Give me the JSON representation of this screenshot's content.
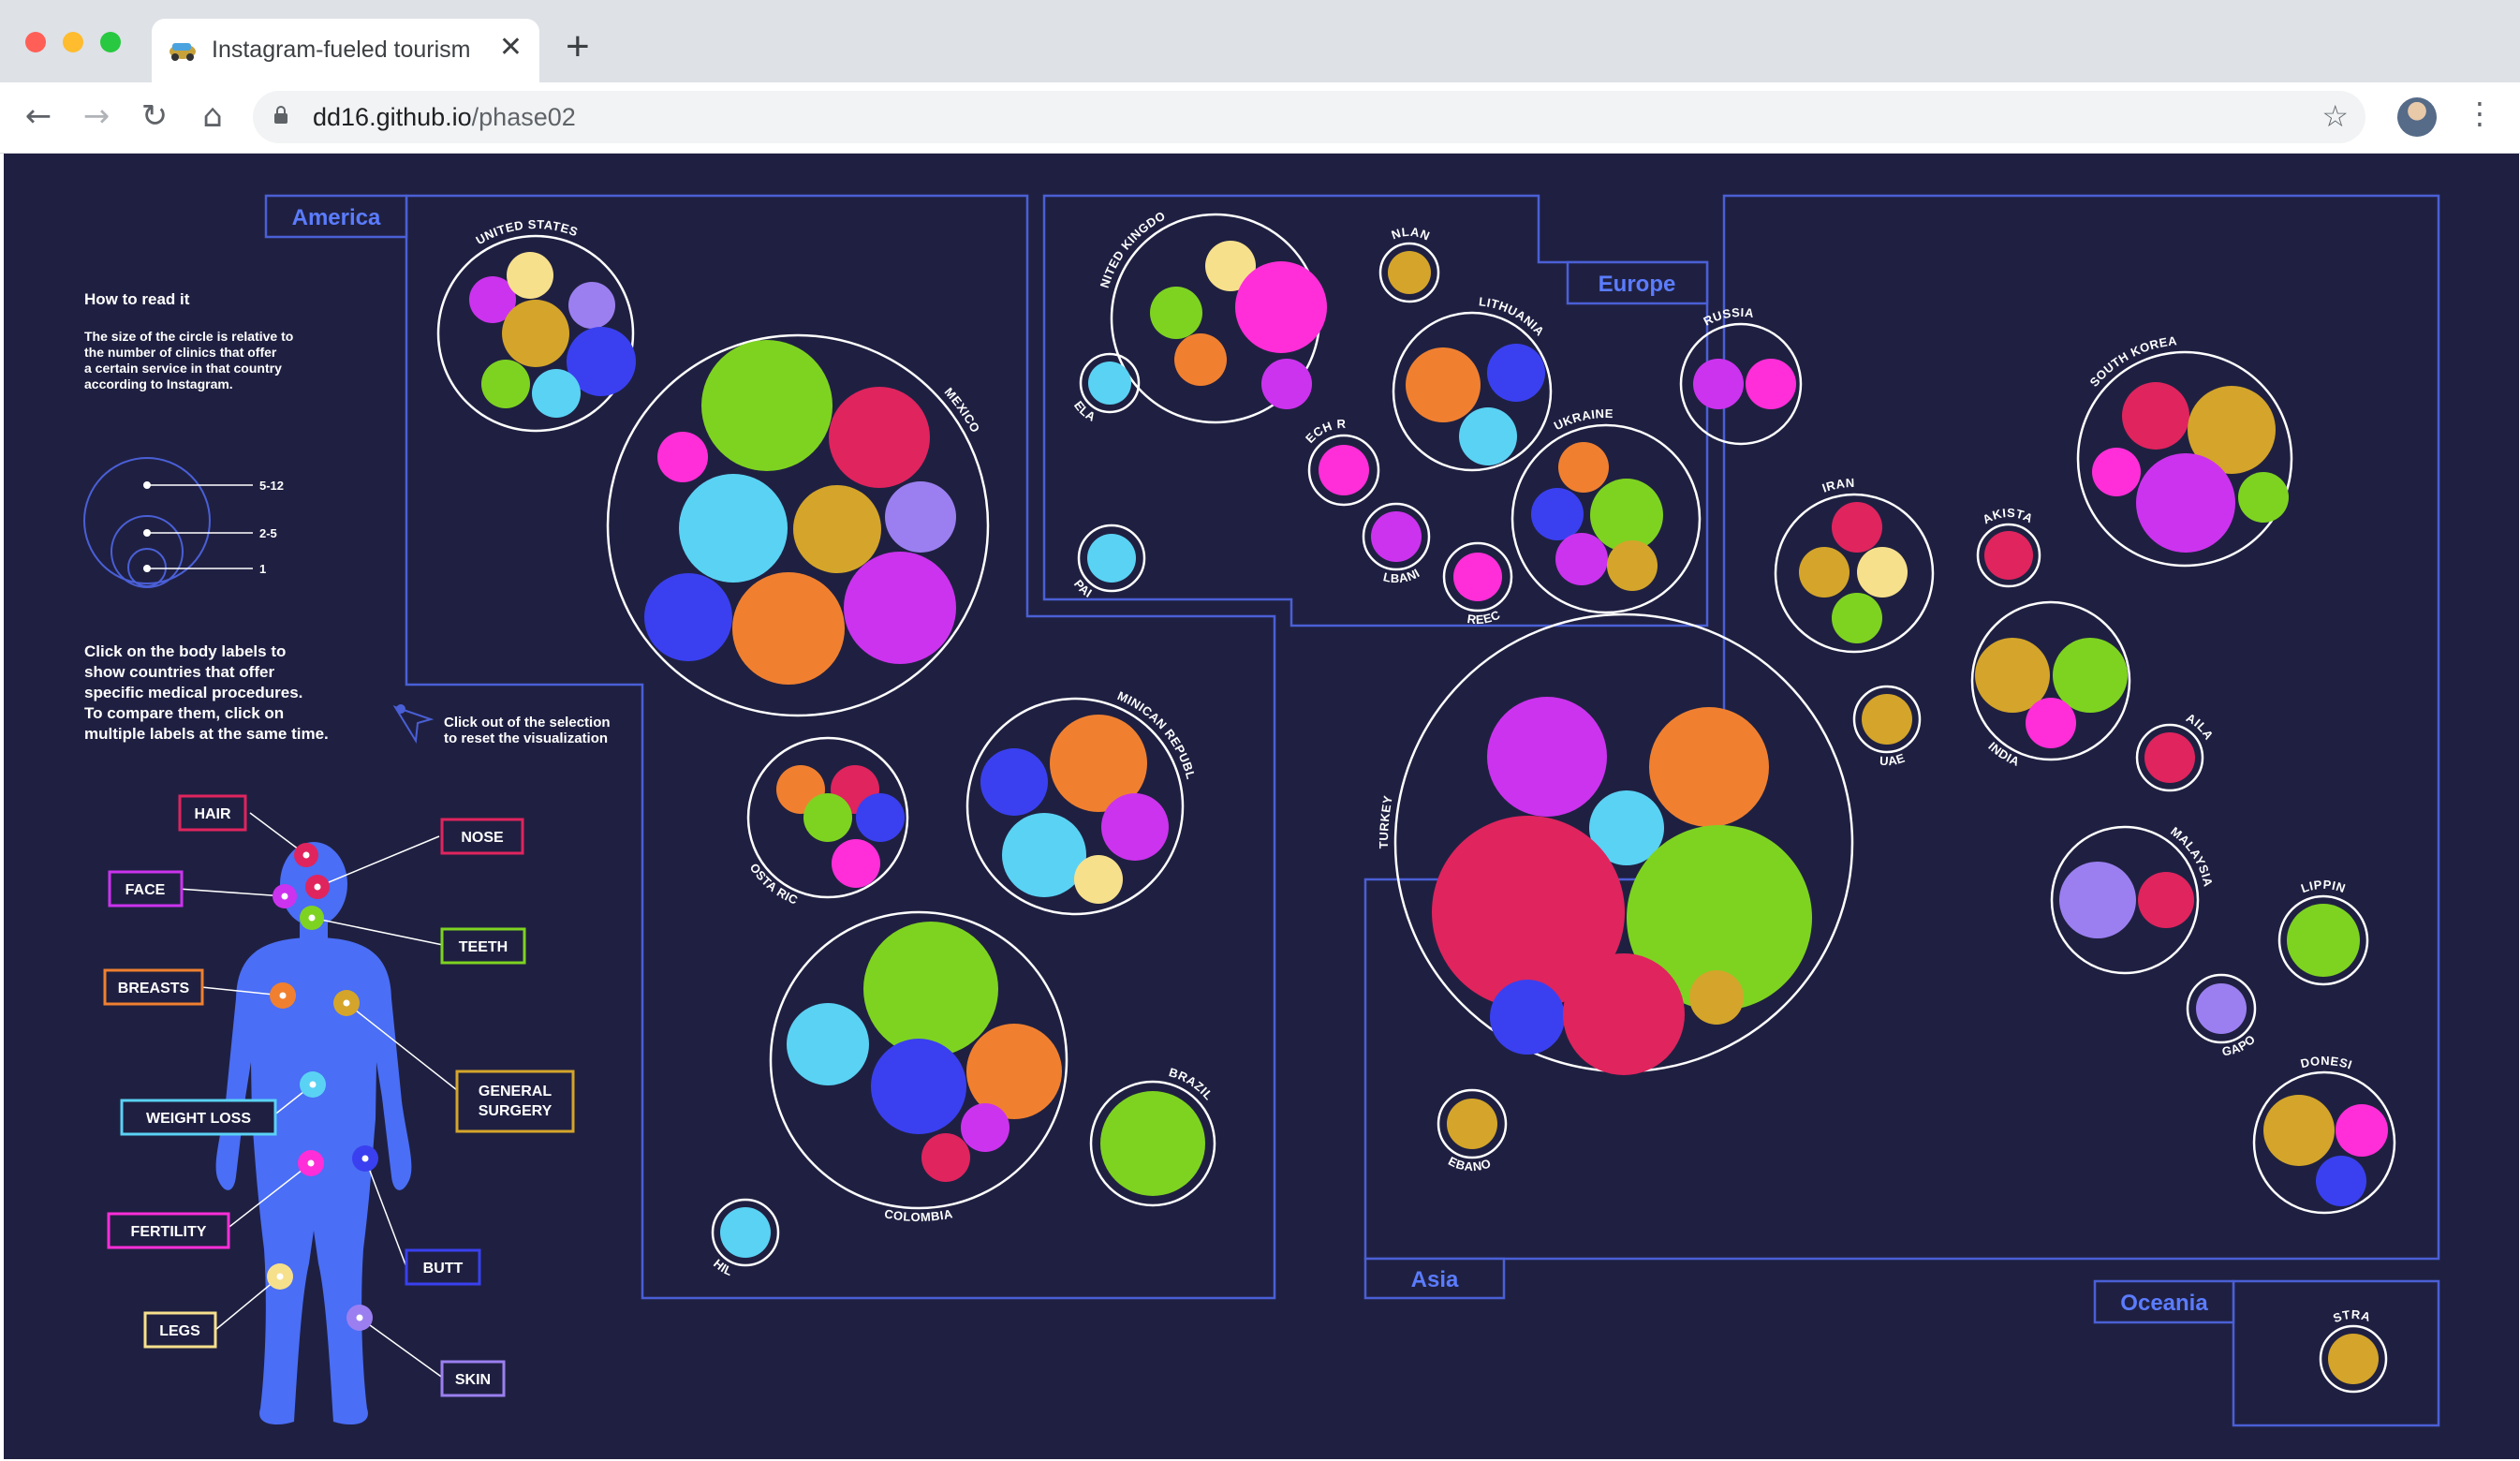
{
  "browser": {
    "tab_title": "Instagram-fueled tourism",
    "url_domain": "dd16.github.io",
    "url_path": "/phase02",
    "new_tab_label": "+",
    "close_label": "✕"
  },
  "colors": {
    "background": "#1f2041",
    "region_stroke": "#4a5fd6",
    "region_label": "#5b7cff",
    "body": "#4a6ef5",
    "hair": "#e0245e",
    "face": "#cc33ee",
    "nose": "#e0245e",
    "teeth": "#7ed321",
    "breasts": "#f08030",
    "general_surgery": "#d4a52a",
    "weight_loss": "#5ad2f4",
    "fertility": "#ff2ed8",
    "butt": "#3a40f0",
    "legs": "#f7e08c",
    "skin": "#9b7ff0"
  },
  "regions": {
    "america": "America",
    "europe": "Europe",
    "asia": "Asia",
    "oceania": "Oceania"
  },
  "legend": {
    "heading": "How to read it",
    "body": [
      "The size of the circle is relative to",
      "the number of clinics that offer",
      "a certain service in that country",
      "according to Instagram."
    ],
    "scale": [
      "5-12",
      "2-5",
      "1"
    ]
  },
  "instructions": {
    "lines": [
      "Click on the body labels to",
      "show countries that offer",
      "specific medical procedures.",
      "To compare them, click on",
      "multiple labels at the same time."
    ],
    "reset_hint": [
      "Click out of the selection",
      "to reset the visualization"
    ]
  },
  "body_labels": {
    "hair": "HAIR",
    "face": "FACE",
    "nose": "NOSE",
    "teeth": "TEETH",
    "breasts": "BREASTS",
    "general_surgery_line1": "GENERAL",
    "general_surgery_line2": "SURGERY",
    "weight_loss": "WEIGHT LOSS",
    "fertility": "FERTILITY",
    "butt": "BUTT",
    "legs": "LEGS",
    "skin": "SKIN"
  },
  "countries": [
    {
      "name": "UNITED STATES",
      "services": [
        "face",
        "legs",
        "skin",
        "general_surgery",
        "butt",
        "teeth",
        "weight_loss"
      ]
    },
    {
      "name": "MEXICO",
      "services": [
        "teeth",
        "hair",
        "fertility",
        "weight_loss",
        "general_surgery",
        "skin",
        "butt",
        "breasts",
        "face"
      ]
    },
    {
      "name": "COSTA RICA",
      "services": [
        "breasts",
        "hair",
        "teeth",
        "butt",
        "fertility"
      ]
    },
    {
      "name": "DOMINICAN REPUBLIC",
      "services": [
        "breasts",
        "butt",
        "face",
        "weight_loss",
        "legs"
      ]
    },
    {
      "name": "COLOMBIA",
      "services": [
        "teeth",
        "weight_loss",
        "breasts",
        "butt",
        "face",
        "hair"
      ]
    },
    {
      "name": "BRAZIL",
      "services": [
        "teeth"
      ]
    },
    {
      "name": "CHILE",
      "services": [
        "weight_loss"
      ]
    },
    {
      "name": "UNITED KINGDOM",
      "services": [
        "legs",
        "teeth",
        "fertility",
        "breasts",
        "face"
      ]
    },
    {
      "name": "FINLAND",
      "services": [
        "general_surgery"
      ]
    },
    {
      "name": "IRELAND",
      "services": [
        "weight_loss"
      ]
    },
    {
      "name": "SPAIN",
      "services": [
        "weight_loss"
      ]
    },
    {
      "name": "LITHUANIA",
      "services": [
        "breasts",
        "butt",
        "weight_loss"
      ]
    },
    {
      "name": "CZECH REP.",
      "services": [
        "fertility"
      ]
    },
    {
      "name": "ALBANIA",
      "services": [
        "face"
      ]
    },
    {
      "name": "GREECE",
      "services": [
        "fertility"
      ]
    },
    {
      "name": "UKRAINE",
      "services": [
        "breasts",
        "butt",
        "teeth",
        "face",
        "general_surgery"
      ]
    },
    {
      "name": "RUSSIA",
      "services": [
        "face",
        "fertility"
      ]
    },
    {
      "name": "TURKEY",
      "services": [
        "face",
        "breasts",
        "weight_loss",
        "nose",
        "teeth",
        "butt",
        "hair",
        "general_surgery"
      ]
    },
    {
      "name": "LEBANON",
      "services": [
        "general_surgery"
      ]
    },
    {
      "name": "IRAN",
      "services": [
        "hair",
        "general_surgery",
        "legs",
        "teeth"
      ]
    },
    {
      "name": "UAE",
      "services": [
        "general_surgery"
      ]
    },
    {
      "name": "PAKISTAN",
      "services": [
        "hair"
      ]
    },
    {
      "name": "INDIA",
      "services": [
        "general_surgery",
        "teeth",
        "fertility"
      ]
    },
    {
      "name": "SOUTH KOREA",
      "services": [
        "hair",
        "general_surgery",
        "fertility",
        "face",
        "teeth"
      ]
    },
    {
      "name": "THAILAND",
      "services": [
        "hair"
      ]
    },
    {
      "name": "MALAYSIA",
      "services": [
        "skin",
        "nose"
      ]
    },
    {
      "name": "SINGAPORE",
      "services": [
        "skin"
      ]
    },
    {
      "name": "PHILIPPINES",
      "services": [
        "teeth"
      ]
    },
    {
      "name": "INDONESIA",
      "services": [
        "general_surgery",
        "fertility",
        "butt"
      ]
    },
    {
      "name": "AUSTRALIA",
      "services": [
        "general_surgery"
      ]
    }
  ]
}
